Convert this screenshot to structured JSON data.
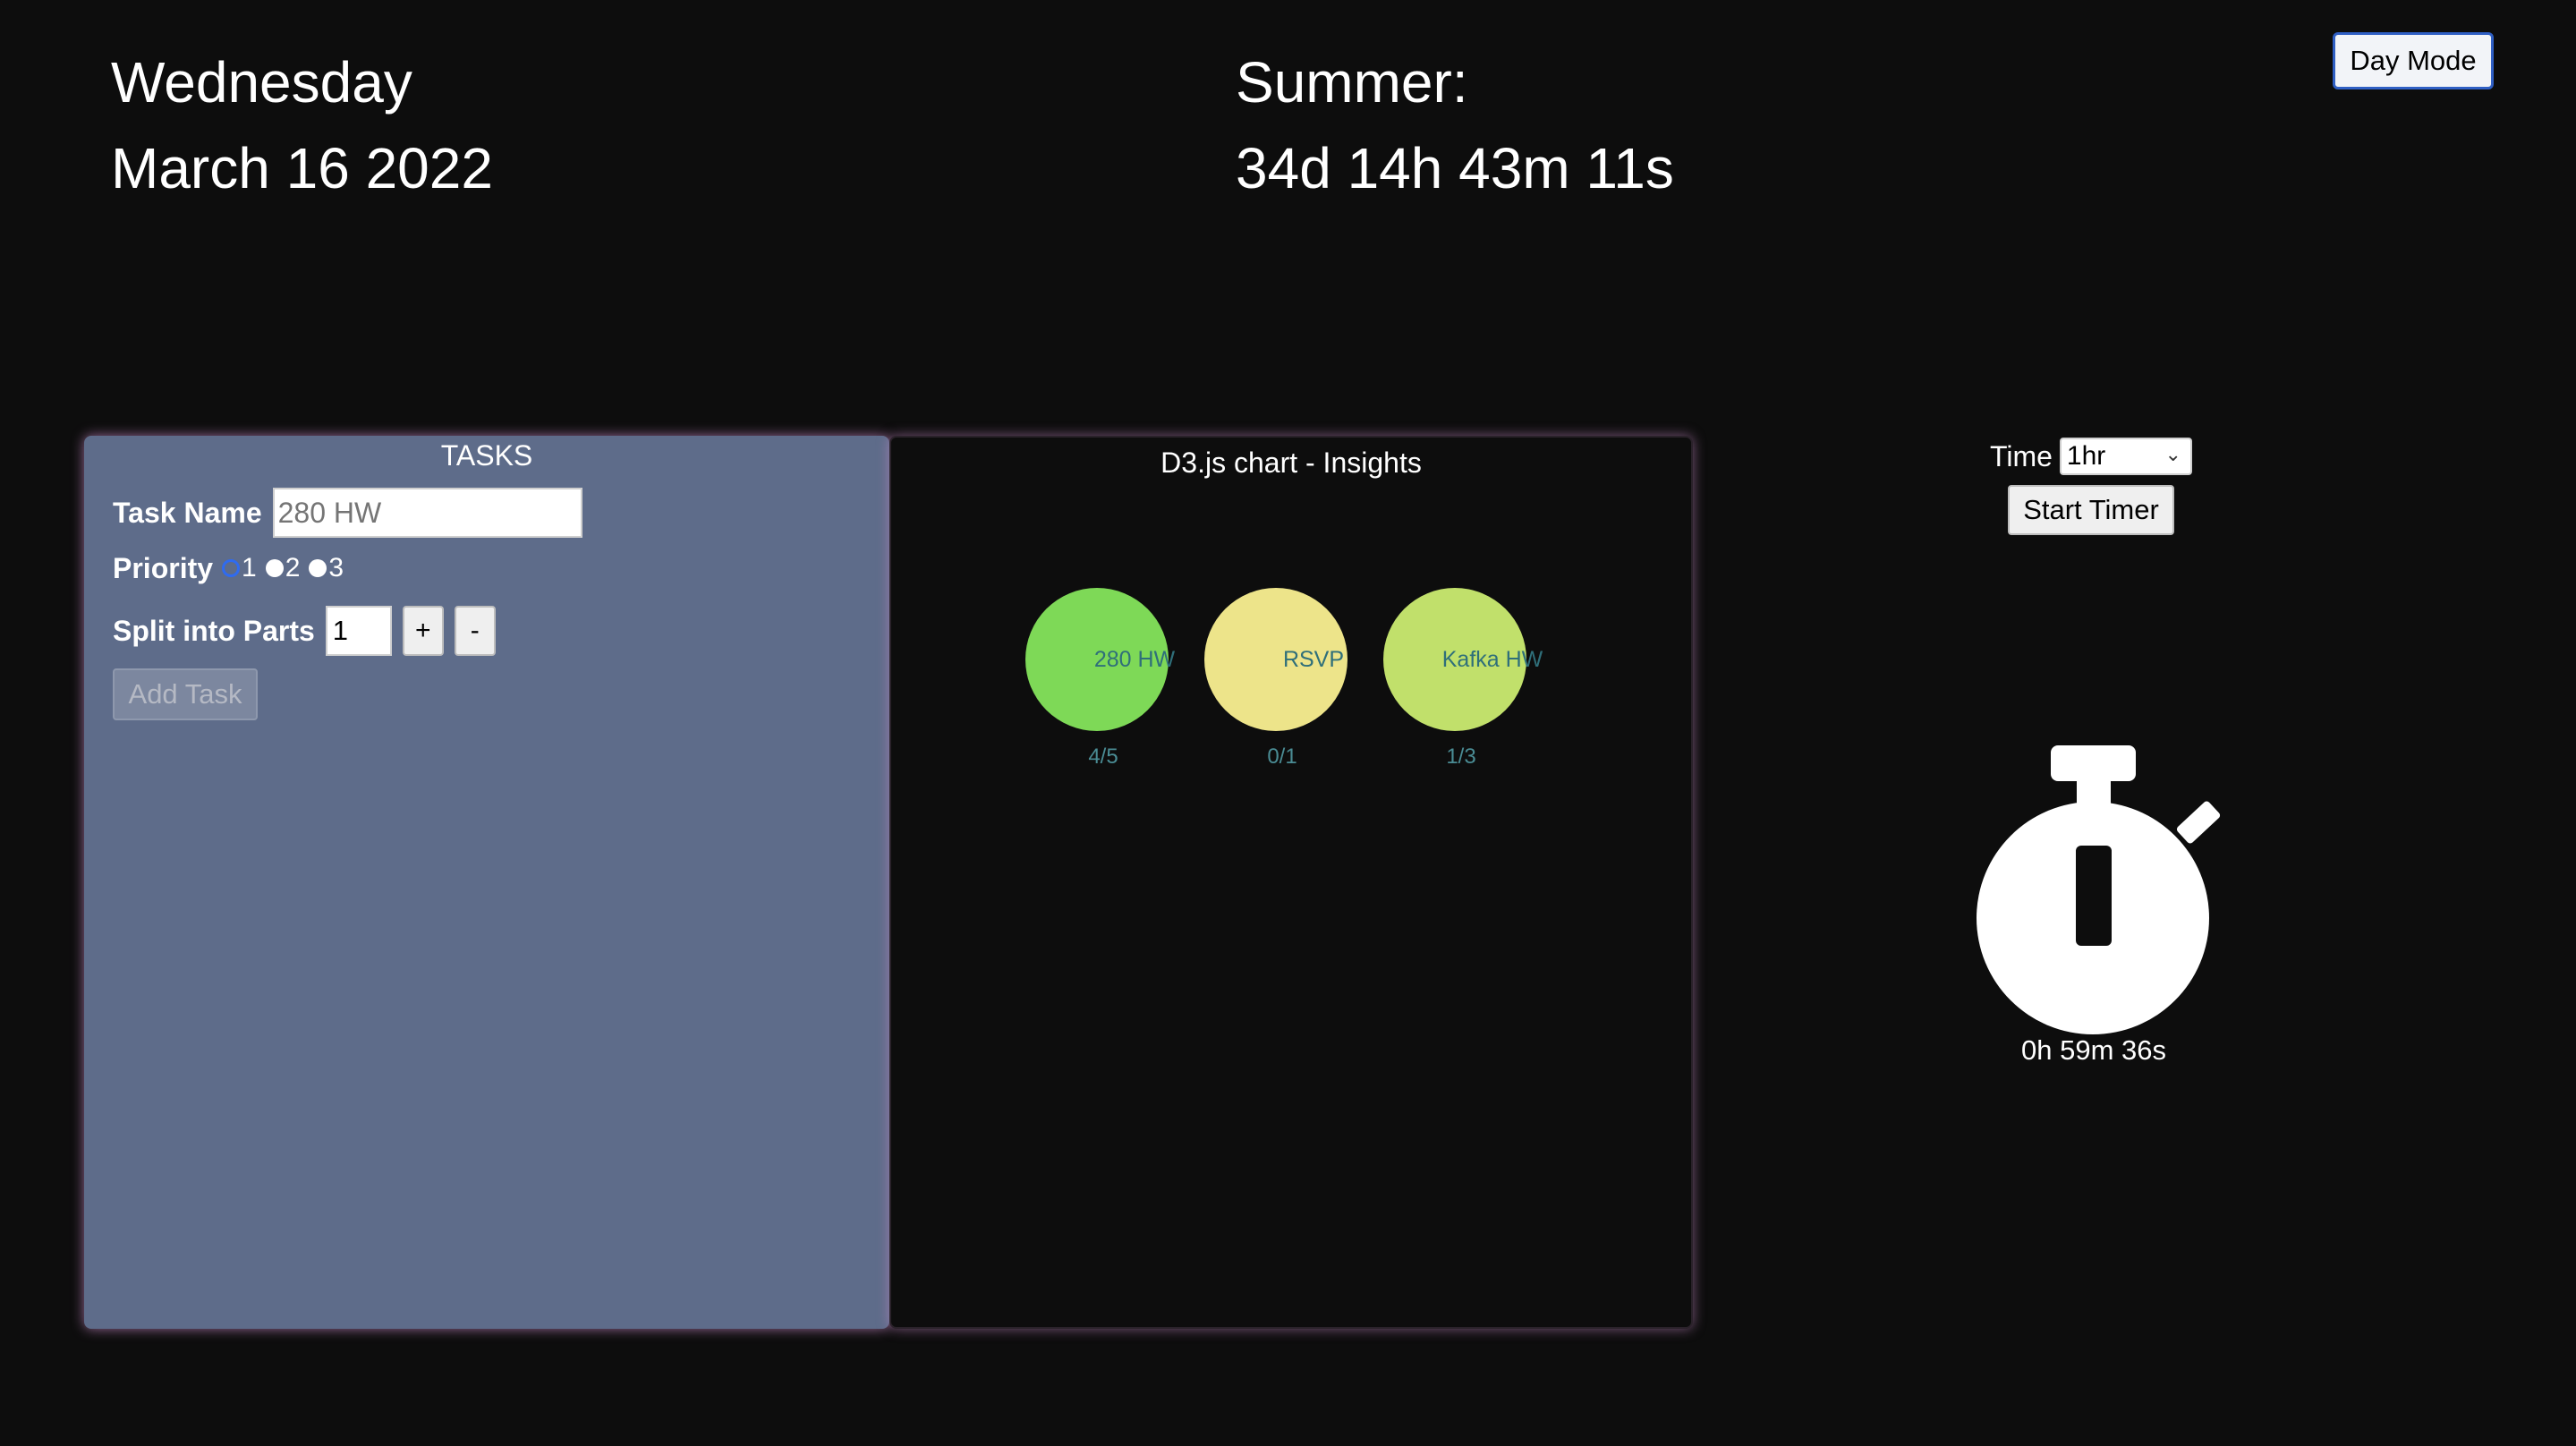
{
  "header": {
    "day": "Wednesday",
    "date": "March 16 2022",
    "countdown_label": "Summer:",
    "countdown_value": "34d 14h 43m 11s",
    "mode_button": "Day Mode"
  },
  "tasks": {
    "title": "TASKS",
    "task_name_label": "Task Name",
    "task_name_placeholder": "280 HW",
    "priority_label": "Priority",
    "priority_options": [
      "1",
      "2",
      "3"
    ],
    "priority_selected": "1",
    "split_label": "Split into Parts",
    "split_value": "1",
    "plus_label": "+",
    "minus_label": "-",
    "add_task_label": "Add Task"
  },
  "chart": {
    "title": "D3.js chart - Insights"
  },
  "chart_data": {
    "type": "bubble",
    "title": "D3.js chart - Insights",
    "items": [
      {
        "label": "280 HW",
        "progress": "4/5",
        "done": 4,
        "total": 5,
        "color": "#7ed957"
      },
      {
        "label": "RSVP",
        "progress": "0/1",
        "done": 0,
        "total": 1,
        "color": "#ede48a"
      },
      {
        "label": "Kafka HW",
        "progress": "1/3",
        "done": 1,
        "total": 3,
        "color": "#c1e06b"
      }
    ]
  },
  "timer": {
    "time_label": "Time",
    "time_selected": "1hr",
    "start_label": "Start Timer",
    "readout": "0h 59m 36s"
  },
  "colors": {
    "background": "#0d0d0d",
    "tasks_panel": "#5e6c8a",
    "panel_glow": "#c488c4",
    "accent_blue": "#2f6bf0"
  },
  "icons": {
    "stopwatch": "stopwatch-icon",
    "select_chevron": "chevron-down-icon"
  }
}
